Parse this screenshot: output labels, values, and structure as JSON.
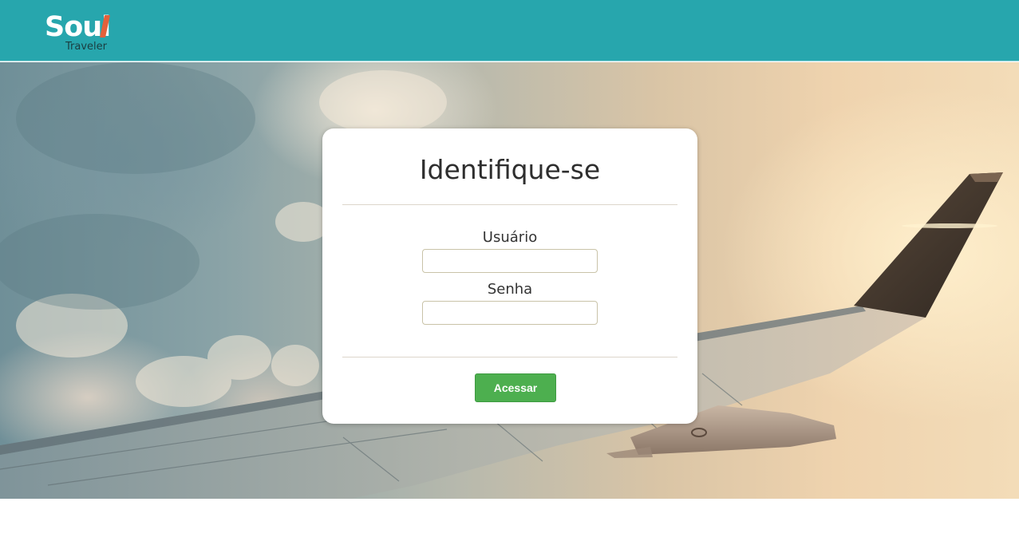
{
  "header": {
    "logo_main": "Soul",
    "logo_sub": "Traveler",
    "background_color": "#27a6ad"
  },
  "login": {
    "title": "Identifique-se",
    "username_label": "Usuário",
    "username_value": "",
    "password_label": "Senha",
    "password_value": "",
    "submit_label": "Acessar",
    "submit_color": "#4daf4f"
  }
}
